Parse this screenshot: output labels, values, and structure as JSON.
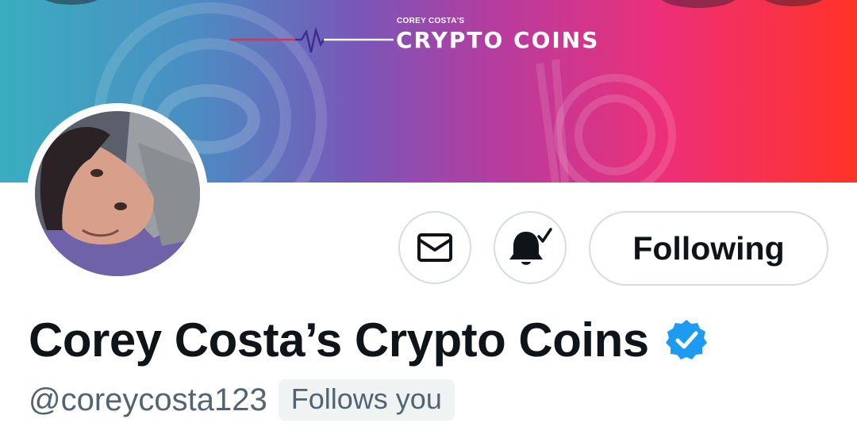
{
  "banner": {
    "kicker": "COREY COSTA'S",
    "title": "CRYPTO COINS"
  },
  "profile": {
    "display_name": "Corey Costa’s Crypto Coins",
    "handle": "@coreycosta123",
    "follows_you_label": "Follows you",
    "verified": true
  },
  "actions": {
    "message_icon": "envelope-icon",
    "notify_icon": "bell-check-icon",
    "following_label": "Following"
  },
  "colors": {
    "text_primary": "#0f1419",
    "text_secondary": "#536471",
    "verified_blue": "#1d9bf0",
    "button_border": "#d6dce0",
    "badge_bg": "#eff3f4"
  }
}
